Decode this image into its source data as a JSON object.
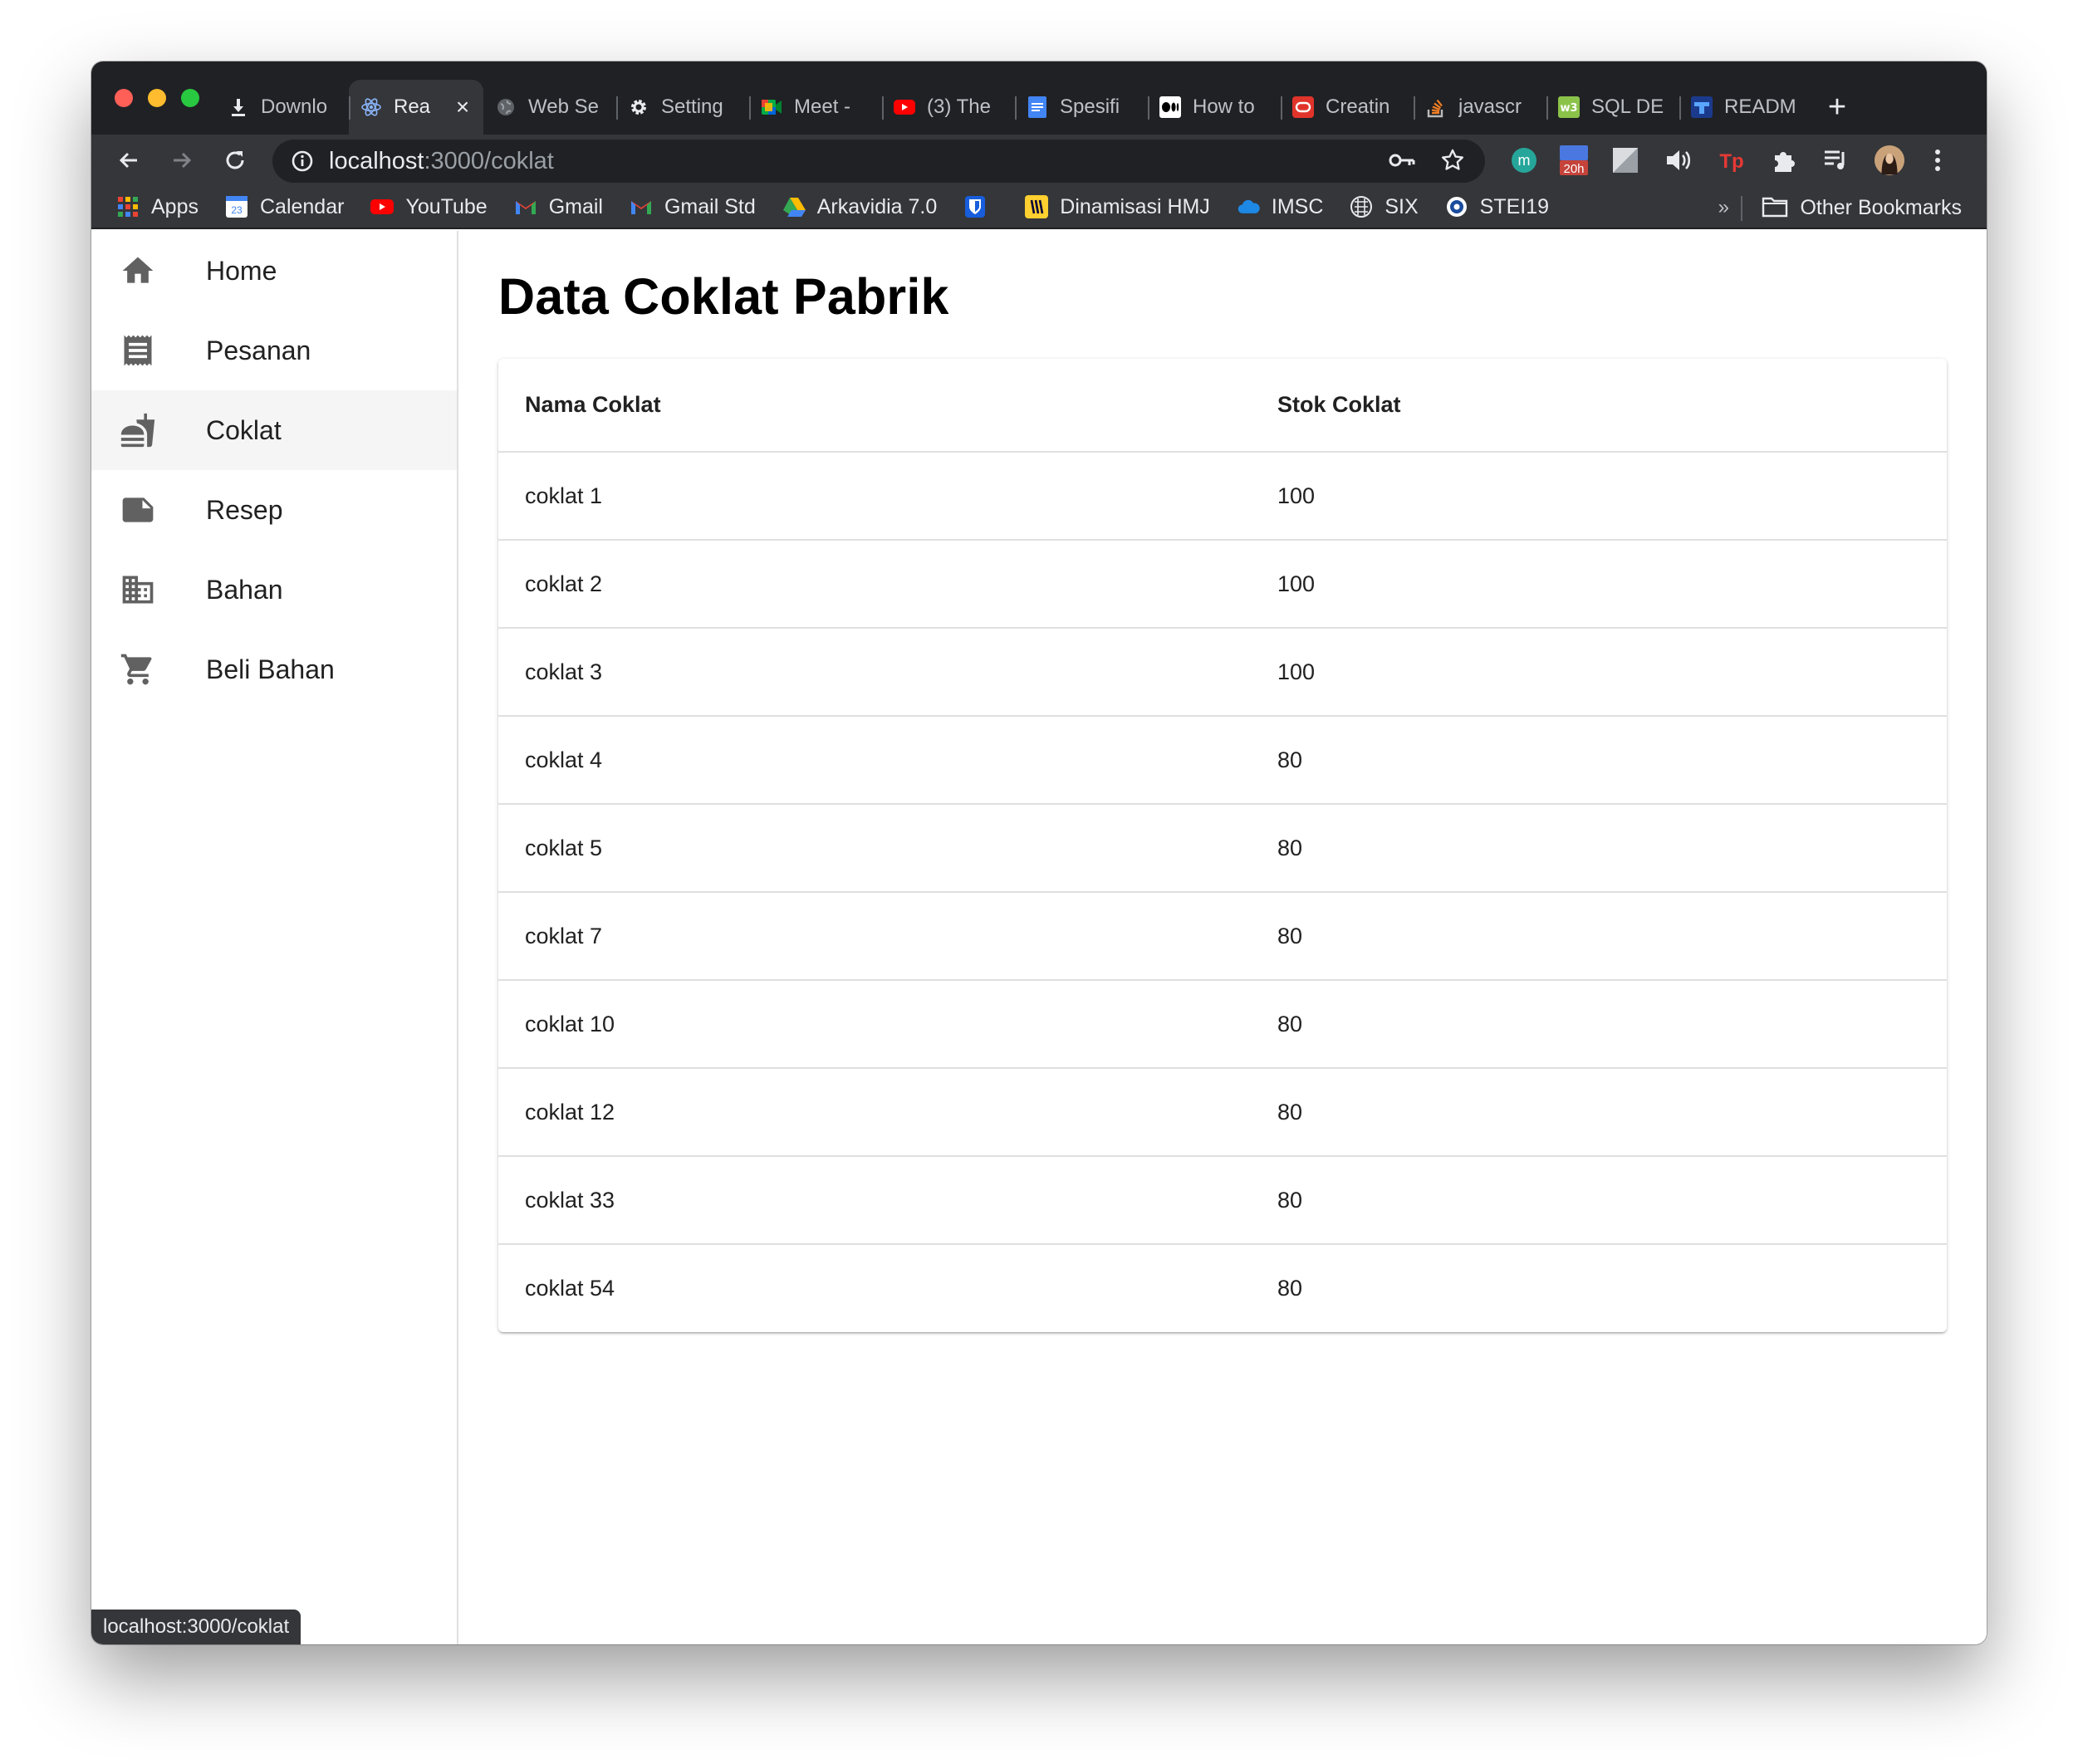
{
  "browser": {
    "tabs": [
      {
        "title": "Downlo",
        "icon": "download-icon"
      },
      {
        "title": "Rea",
        "icon": "react-icon",
        "active": true
      },
      {
        "title": "Web Se",
        "icon": "globe-icon"
      },
      {
        "title": "Setting",
        "icon": "gear-icon"
      },
      {
        "title": "Meet -",
        "icon": "google-meet-icon"
      },
      {
        "title": "(3) The",
        "icon": "youtube-icon"
      },
      {
        "title": "Spesifi",
        "icon": "google-docs-icon"
      },
      {
        "title": "How to",
        "icon": "medium-icon"
      },
      {
        "title": "Creatin",
        "icon": "oracle-icon"
      },
      {
        "title": "javascr",
        "icon": "stackoverflow-icon"
      },
      {
        "title": "SQL DE",
        "icon": "w3schools-icon"
      },
      {
        "title": "READM",
        "icon": "markdown-icon"
      }
    ],
    "url_host": "localhost",
    "url_path": ":3000/coklat",
    "calendar_badge": "20h",
    "extension_m": "m",
    "extension_tp": "Tp",
    "bookmarks": [
      {
        "label": "Apps",
        "icon": "apps-grid-icon"
      },
      {
        "label": "Calendar",
        "icon": "google-calendar-icon",
        "badge": "23"
      },
      {
        "label": "YouTube",
        "icon": "youtube-icon"
      },
      {
        "label": "Gmail",
        "icon": "gmail-icon"
      },
      {
        "label": "Gmail Std",
        "icon": "gmail-icon"
      },
      {
        "label": "Arkavidia 7.0",
        "icon": "google-drive-icon"
      },
      {
        "label": "",
        "icon": "bitwarden-icon"
      },
      {
        "label": "Dinamisasi HMJ",
        "icon": "miro-icon"
      },
      {
        "label": "IMSC",
        "icon": "onedrive-icon"
      },
      {
        "label": "SIX",
        "icon": "six-icon"
      },
      {
        "label": "STEI19",
        "icon": "stei-icon"
      }
    ],
    "bookmarks_overflow": "»",
    "other_bookmarks": "Other Bookmarks",
    "status_url": "localhost:3000/coklat"
  },
  "sidebar": {
    "items": [
      {
        "label": "Home",
        "icon": "home-icon"
      },
      {
        "label": "Pesanan",
        "icon": "receipt-icon"
      },
      {
        "label": "Coklat",
        "icon": "fastfood-icon",
        "active": true
      },
      {
        "label": "Resep",
        "icon": "note-icon"
      },
      {
        "label": "Bahan",
        "icon": "domain-icon"
      },
      {
        "label": "Beli Bahan",
        "icon": "cart-icon"
      }
    ]
  },
  "main": {
    "title": "Data Coklat Pabrik",
    "table": {
      "headers": [
        "Nama Coklat",
        "Stok Coklat"
      ],
      "rows": [
        [
          "coklat 1",
          "100"
        ],
        [
          "coklat 2",
          "100"
        ],
        [
          "coklat 3",
          "100"
        ],
        [
          "coklat 4",
          "80"
        ],
        [
          "coklat 5",
          "80"
        ],
        [
          "coklat 7",
          "80"
        ],
        [
          "coklat 10",
          "80"
        ],
        [
          "coklat 12",
          "80"
        ],
        [
          "coklat 33",
          "80"
        ],
        [
          "coklat 54",
          "80"
        ]
      ]
    }
  },
  "colors": {
    "tabstrip": "#202124",
    "toolbar": "#35363a",
    "sidebar_active": "#f5f5f5",
    "icon_gray": "#616161"
  }
}
